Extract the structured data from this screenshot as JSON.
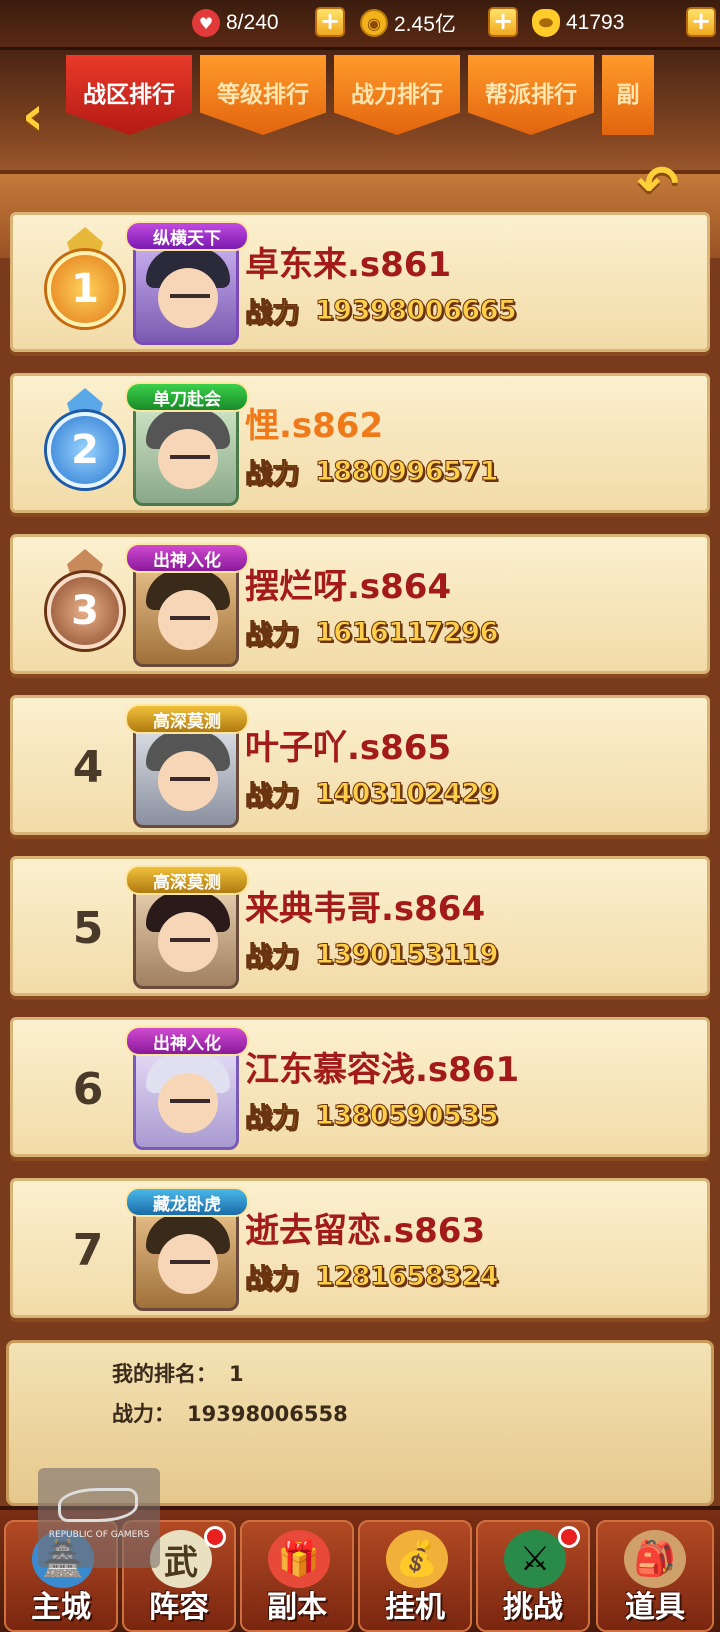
{
  "resources": {
    "stamina": "8/240",
    "copper": "2.45亿",
    "gold": "41793",
    "plus": "+"
  },
  "tabs": [
    "战区排行",
    "等级排行",
    "战力排行",
    "帮派排行",
    "副"
  ],
  "power_label": "战力",
  "rankings": [
    {
      "rank": "1",
      "badge": "纵横天下",
      "name": "卓东来.s861",
      "power": "19398006665"
    },
    {
      "rank": "2",
      "badge": "单刀赴会",
      "name": "悝.s862",
      "power": "1880996571"
    },
    {
      "rank": "3",
      "badge": "出神入化",
      "name": "摆烂呀.s864",
      "power": "1616117296"
    },
    {
      "rank": "4",
      "badge": "高深莫测",
      "name": "叶子吖.s865",
      "power": "1403102429"
    },
    {
      "rank": "5",
      "badge": "高深莫测",
      "name": "来典韦哥.s864",
      "power": "1390153119"
    },
    {
      "rank": "6",
      "badge": "出神入化",
      "name": "江东慕容浅.s861",
      "power": "1380590535"
    },
    {
      "rank": "7",
      "badge": "藏龙卧虎",
      "name": "逝去留恋.s863",
      "power": "1281658324"
    }
  ],
  "my_rank": {
    "rank_label": "我的排名：",
    "rank_value": "1",
    "power_label": "战力：",
    "power_value": "19398006558"
  },
  "watermark": "REPUBLIC OF GAMERS",
  "nav": [
    "主城",
    "阵容",
    "副本",
    "挂机",
    "挑战",
    "道具"
  ],
  "colors": {
    "name_red": "#a21a1a",
    "name_orange": "#f07a1a",
    "tab_active": "#c8241a",
    "tab_inactive": "#f07e1a"
  }
}
